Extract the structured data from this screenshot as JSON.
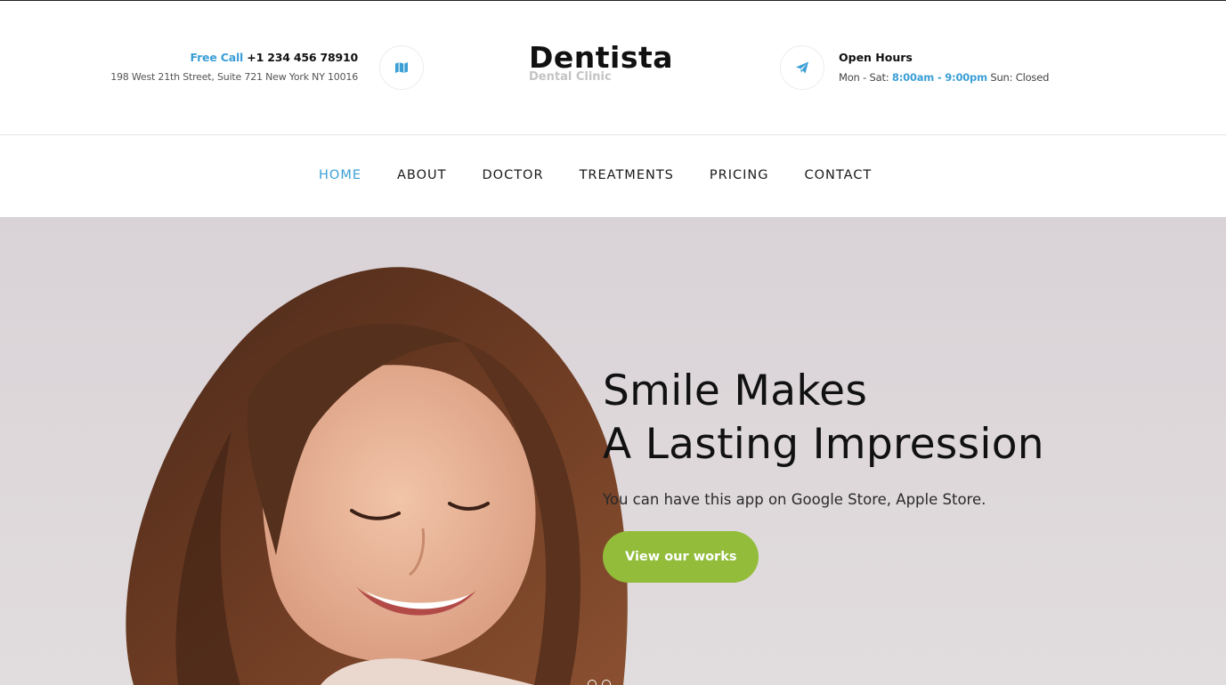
{
  "header": {
    "call_label": "Free Call",
    "phone": "+1 234 456 78910",
    "address": "198 West 21th Street, Suite 721 New York NY 10016",
    "logo_name": "Dentista",
    "logo_tagline": "Dental Clinic",
    "hours_title": "Open Hours",
    "hours_prefix": "Mon - Sat:",
    "hours_time": "8:00am - 9:00pm",
    "hours_suffix": "Sun: Closed",
    "map_icon": "map-icon",
    "send_icon": "paper-plane-icon"
  },
  "nav": {
    "items": [
      {
        "label": "HOME",
        "active": true
      },
      {
        "label": "ABOUT",
        "active": false
      },
      {
        "label": "DOCTOR",
        "active": false
      },
      {
        "label": "TREATMENTS",
        "active": false
      },
      {
        "label": "PRICING",
        "active": false
      },
      {
        "label": "CONTACT",
        "active": false
      }
    ]
  },
  "hero": {
    "title_line1": "Smile Makes",
    "title_line2": "A Lasting Impression",
    "subtitle": "You can have this app on Google Store, Apple Store.",
    "button_label": "View our works"
  },
  "colors": {
    "accent_blue": "#3b9fd6",
    "button_green": "#92bc3a",
    "hero_bg": "#ddd7da"
  }
}
